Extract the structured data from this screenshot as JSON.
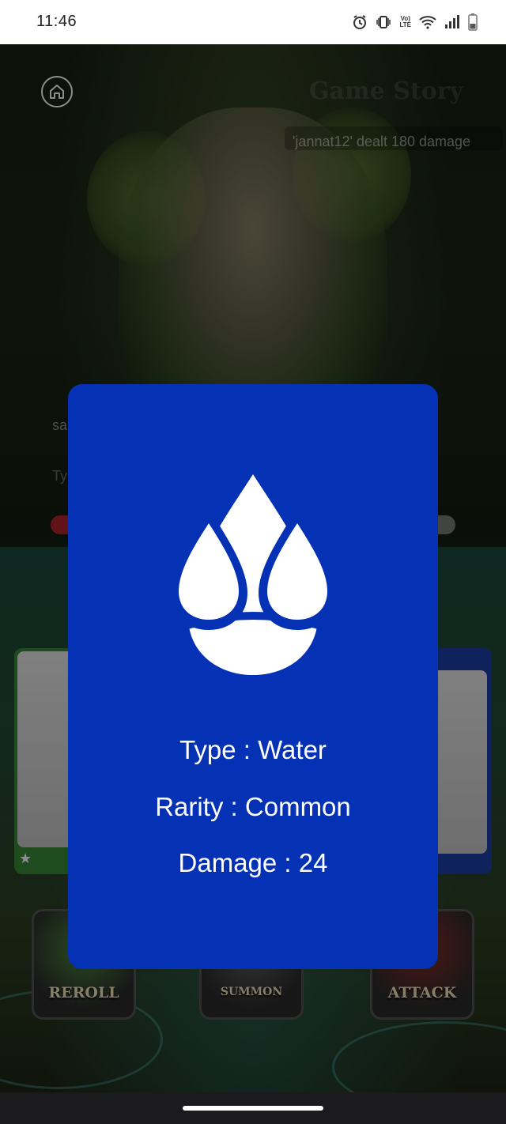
{
  "status_bar": {
    "time": "11:46",
    "icons": [
      "alarm-icon",
      "vibrate-icon",
      "volte-icon",
      "wifi-icon",
      "signal-icon",
      "battery-icon"
    ]
  },
  "game": {
    "title": "Game Story",
    "story_log": "'jannat12' dealt 180 damage",
    "chat_line": "sa",
    "chat_input_hint": "Ty",
    "buttons": {
      "reroll": "REROLL",
      "summon": "SUMMON",
      "attack": "ATTACK"
    }
  },
  "card_detail": {
    "element_icon": "water-drops-icon",
    "type_text": "Type : Water",
    "rarity_text": "Rarity : Common",
    "damage_text": "Damage : 24",
    "colors": {
      "modal_background": "#0532b5",
      "text": "#ffffff"
    }
  }
}
